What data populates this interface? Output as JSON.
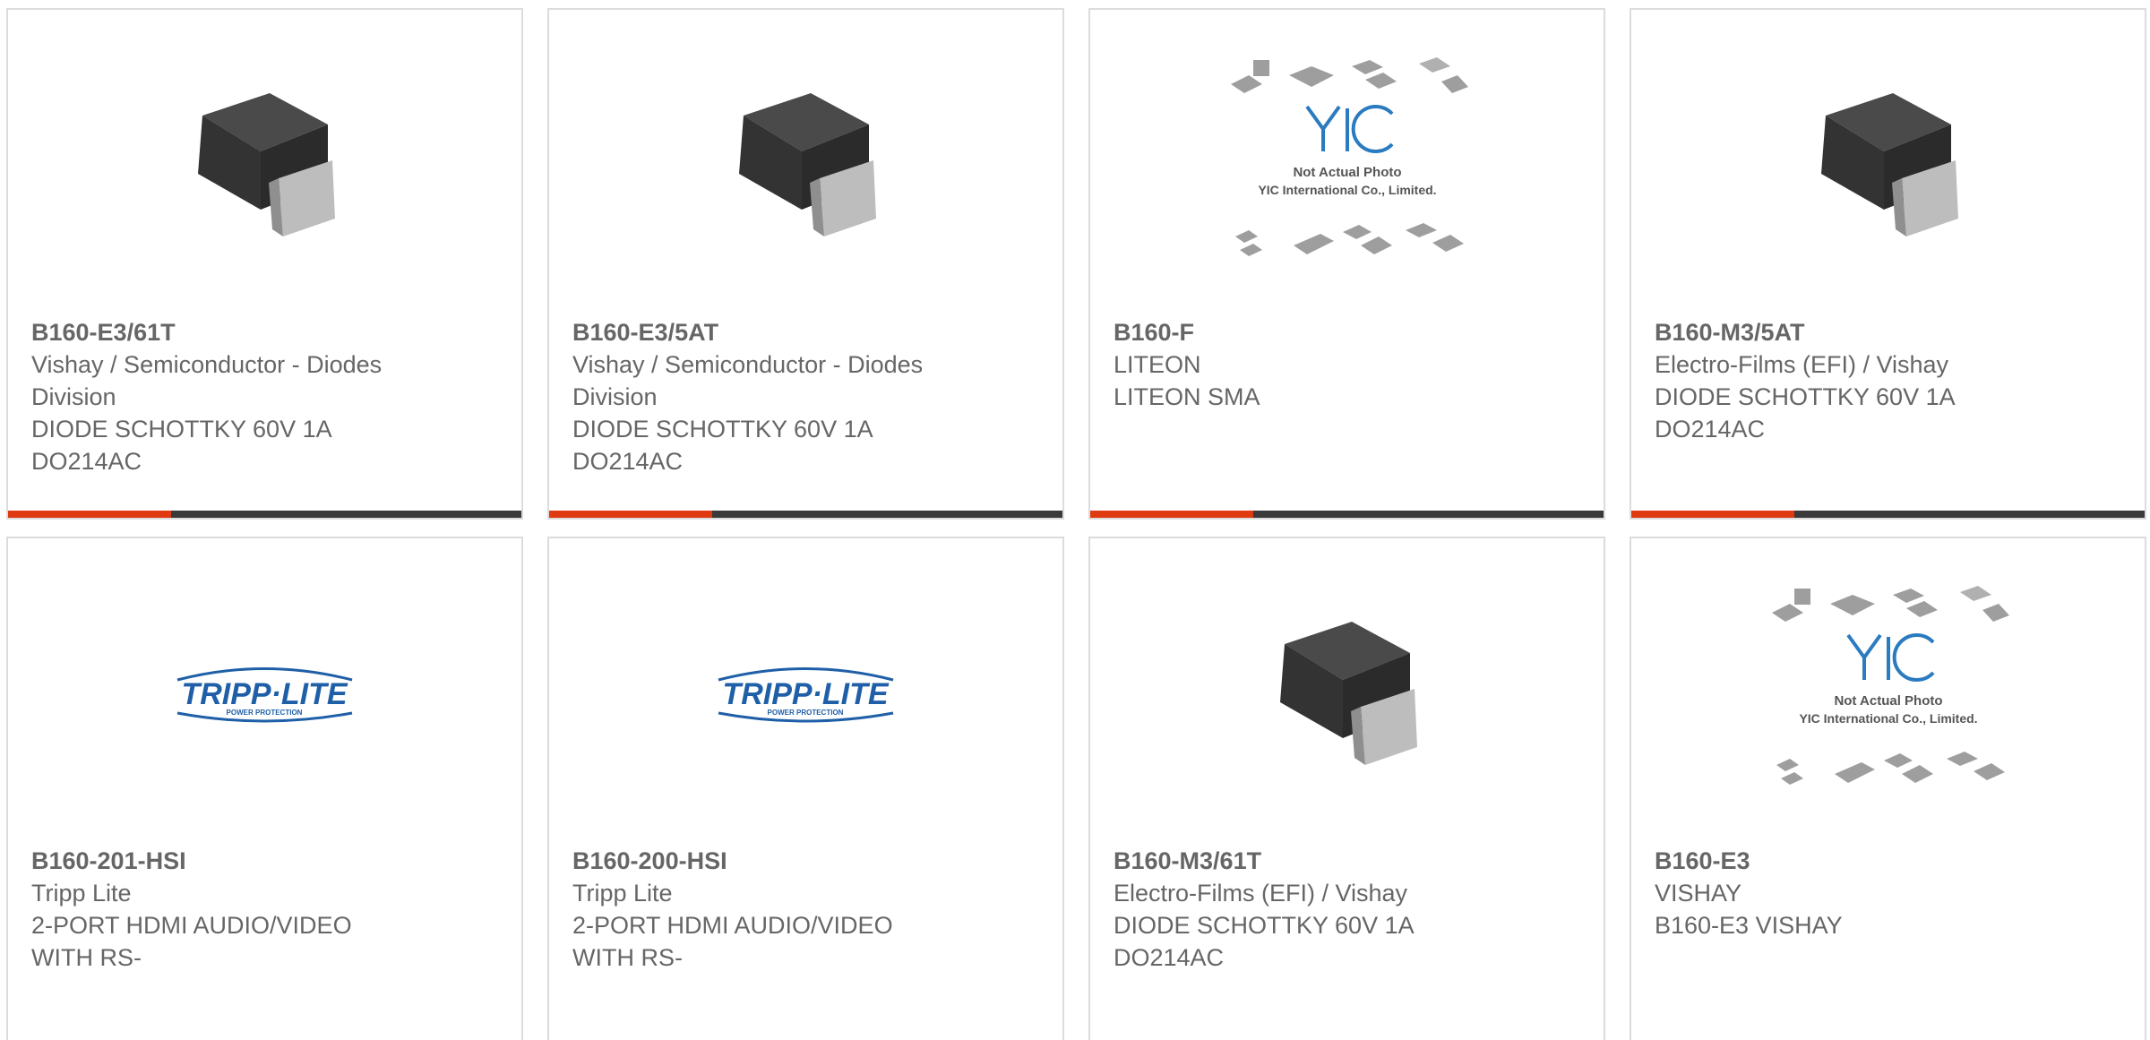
{
  "products": [
    {
      "part_number": "B160-E3/61T",
      "manufacturer_lines": [
        "Vishay / Semiconductor - Diodes",
        "Division"
      ],
      "description_lines": [
        "DIODE SCHOTTKY 60V 1A",
        "DO214AC"
      ],
      "image": "diode-package-icon"
    },
    {
      "part_number": "B160-E3/5AT",
      "manufacturer_lines": [
        "Vishay / Semiconductor - Diodes",
        "Division"
      ],
      "description_lines": [
        "DIODE SCHOTTKY 60V 1A",
        "DO214AC"
      ],
      "image": "diode-package-icon"
    },
    {
      "part_number": "B160-F",
      "manufacturer_lines": [
        "LITEON"
      ],
      "description_lines": [
        "LITEON SMA"
      ],
      "image": "yic-placeholder-image",
      "placeholder": {
        "logo": "YIC",
        "line1": "Not Actual Photo",
        "line2": "YIC International Co., Limited."
      }
    },
    {
      "part_number": "B160-M3/5AT",
      "manufacturer_lines": [
        "Electro-Films (EFI) / Vishay"
      ],
      "description_lines": [
        "DIODE SCHOTTKY 60V 1A",
        "DO214AC"
      ],
      "image": "diode-package-icon"
    },
    {
      "part_number": "B160-201-HSI",
      "manufacturer_lines": [
        "Tripp Lite"
      ],
      "description_lines": [
        "2-PORT HDMI AUDIO/VIDEO",
        "WITH RS-"
      ],
      "image": "tripp-lite-logo",
      "logo": {
        "main": "TRIPP·LITE",
        "sub": "POWER PROTECTION"
      }
    },
    {
      "part_number": "B160-200-HSI",
      "manufacturer_lines": [
        "Tripp Lite"
      ],
      "description_lines": [
        "2-PORT HDMI AUDIO/VIDEO",
        "WITH RS-"
      ],
      "image": "tripp-lite-logo",
      "logo": {
        "main": "TRIPP·LITE",
        "sub": "POWER PROTECTION"
      }
    },
    {
      "part_number": "B160-M3/61T",
      "manufacturer_lines": [
        "Electro-Films (EFI) / Vishay"
      ],
      "description_lines": [
        "DIODE SCHOTTKY 60V 1A",
        "DO214AC"
      ],
      "image": "diode-package-icon"
    },
    {
      "part_number": "B160-E3",
      "manufacturer_lines": [
        "VISHAY"
      ],
      "description_lines": [
        "B160-E3 VISHAY"
      ],
      "image": "yic-placeholder-image",
      "placeholder": {
        "logo": "YIC",
        "line1": "Not Actual Photo",
        "line2": "YIC International Co., Limited."
      }
    }
  ],
  "colors": {
    "accent": "#e03a12",
    "bar": "#3a3a3a",
    "text": "#666666",
    "border": "#dcdcdc"
  }
}
